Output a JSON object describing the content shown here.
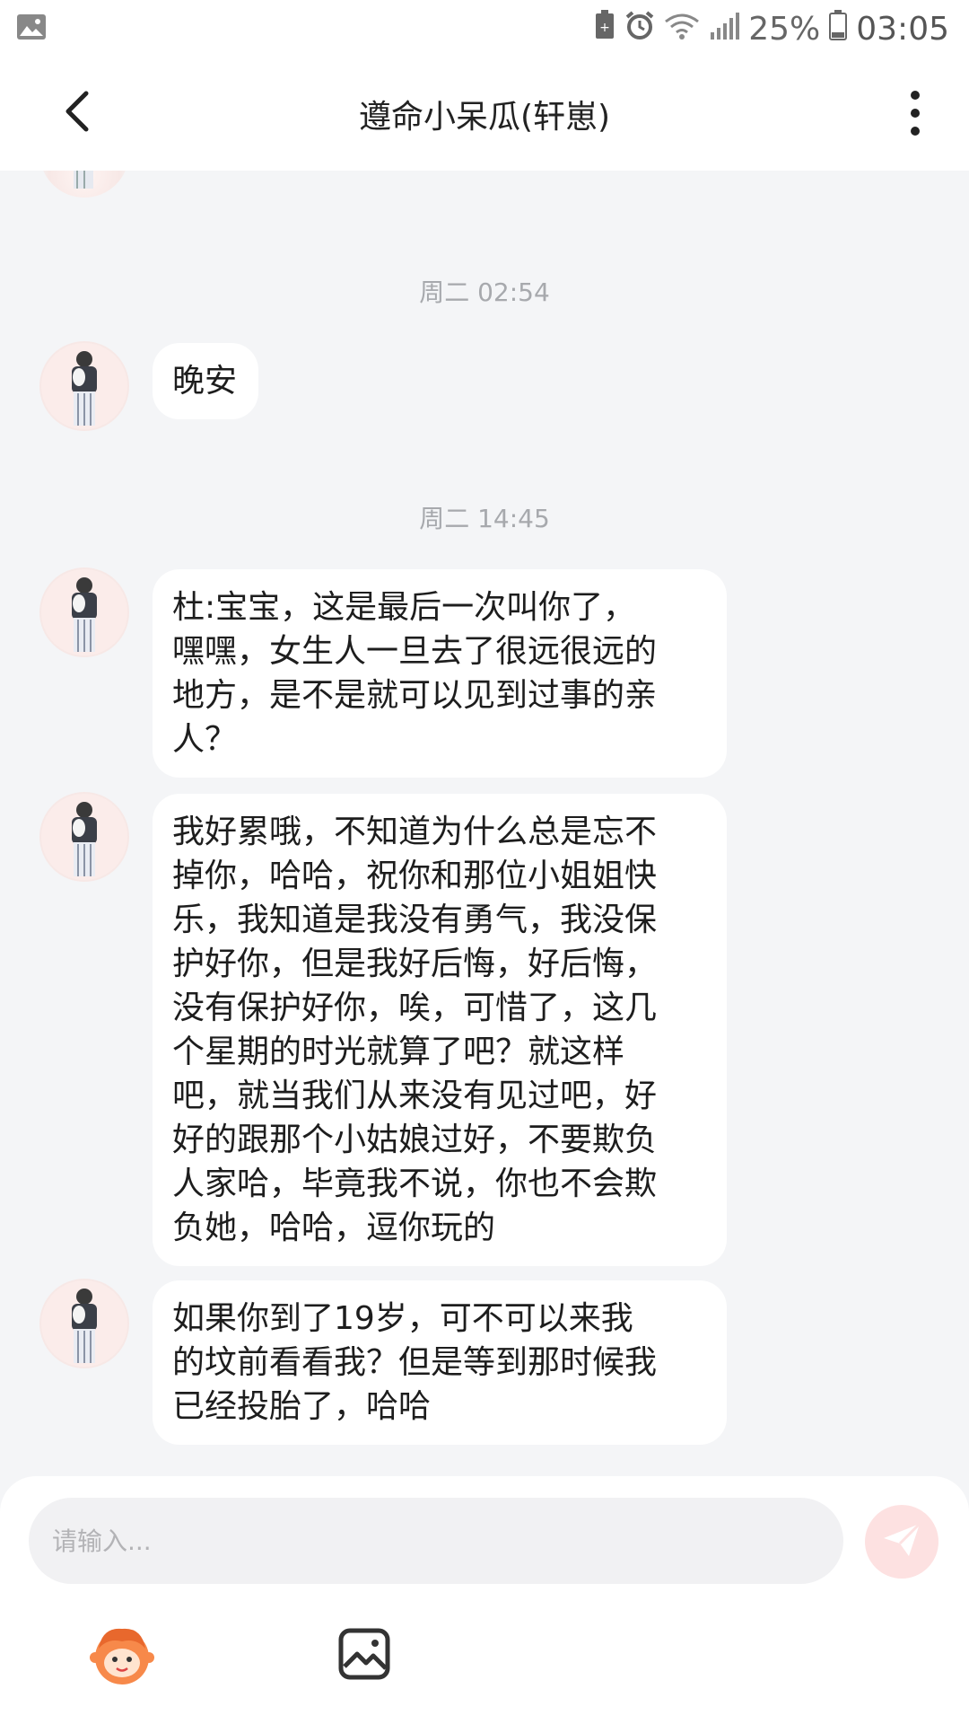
{
  "status_bar": {
    "battery": "25%",
    "time": "03:05"
  },
  "header": {
    "title": "遵命小呆瓜(轩崽)"
  },
  "messages": [
    {
      "type": "time",
      "text": "周二 02:54"
    },
    {
      "type": "received",
      "text": "晚安"
    },
    {
      "type": "time",
      "text": "周二 14:45"
    },
    {
      "type": "received",
      "lines": [
        "杜:宝宝，这是最后一次叫你了，",
        "嘿嘿，女生人一旦去了很远很远的",
        "地方，是不是就可以见到过事的亲",
        "人？"
      ]
    },
    {
      "type": "received",
      "lines": [
        "我好累哦，不知道为什么总是忘不",
        "掉你，哈哈，祝你和那位小姐姐快",
        "乐，我知道是我没有勇气，我没保",
        "护好你，但是我好后悔，好后悔，",
        "没有保护好你，唉，可惜了，这几",
        "个星期的时光就算了吧？就这样",
        "吧，就当我们从来没有见过吧，好",
        "好的跟那个小姑娘过好，不要欺负",
        "人家哈，毕竟我不说，你也不会欺",
        "负她，哈哈，逗你玩的"
      ]
    },
    {
      "type": "received",
      "lines": [
        "如果你到了19岁，可不可以来我",
        "的坟前看看我？但是等到那时候我",
        "已经投胎了，哈哈"
      ]
    }
  ],
  "composer": {
    "placeholder": "请输入..."
  },
  "icons": {
    "back": "back-arrow-icon",
    "more": "more-vertical-icon",
    "send": "send-icon",
    "emoji": "emoji-mascot-icon",
    "image": "image-icon"
  },
  "colors": {
    "background": "#f4f5f7",
    "bubble": "#ffffff",
    "send_button": "#fde1e1",
    "send_icon": "#ffffff"
  }
}
